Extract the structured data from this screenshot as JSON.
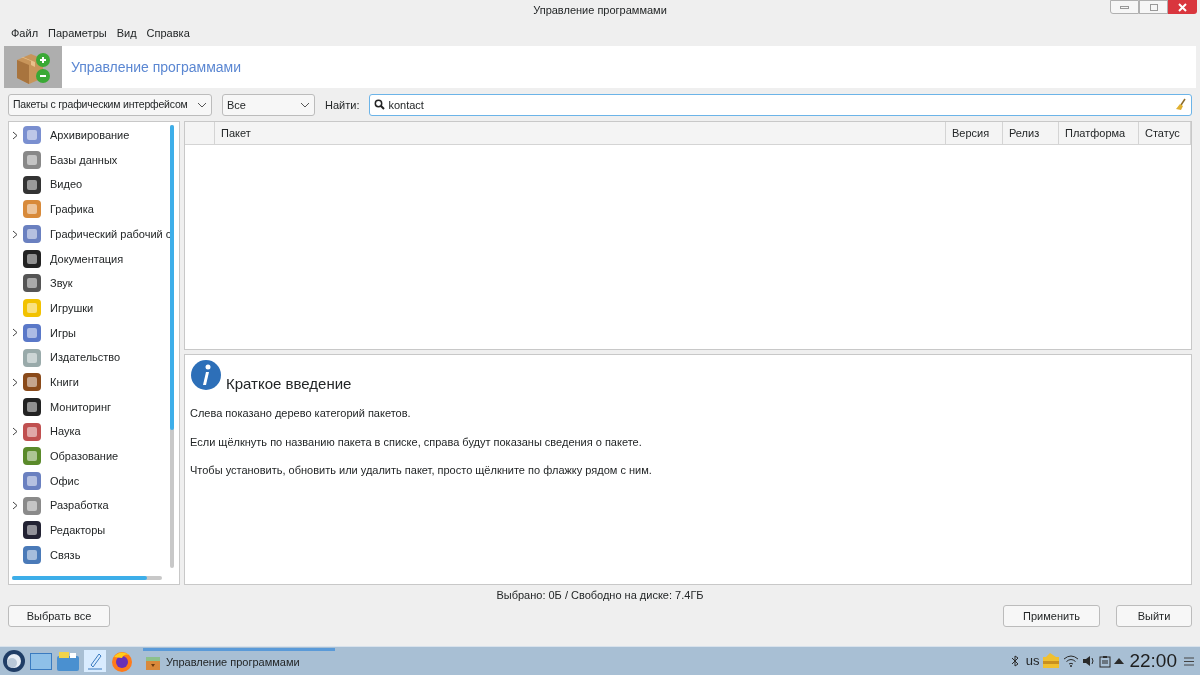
{
  "window": {
    "title": "Управление программами"
  },
  "menu": [
    "Файл",
    "Параметры",
    "Вид",
    "Справка"
  ],
  "header": {
    "title": "Управление программами"
  },
  "filters": {
    "group": "Пакеты с графическим интерфейсом",
    "status": "Все",
    "search_label": "Найти:",
    "search_value": "kontact"
  },
  "categories": [
    {
      "label": "Архивирование",
      "has_children": true
    },
    {
      "label": "Базы данных",
      "has_children": false
    },
    {
      "label": "Видео",
      "has_children": false
    },
    {
      "label": "Графика",
      "has_children": false
    },
    {
      "label": "Графический рабочий с",
      "has_children": true
    },
    {
      "label": "Документация",
      "has_children": false
    },
    {
      "label": "Звук",
      "has_children": false
    },
    {
      "label": "Игрушки",
      "has_children": false
    },
    {
      "label": "Игры",
      "has_children": true
    },
    {
      "label": "Издательство",
      "has_children": false
    },
    {
      "label": "Книги",
      "has_children": true
    },
    {
      "label": "Мониторинг",
      "has_children": false
    },
    {
      "label": "Наука",
      "has_children": true
    },
    {
      "label": "Образование",
      "has_children": false
    },
    {
      "label": "Офис",
      "has_children": false
    },
    {
      "label": "Разработка",
      "has_children": true
    },
    {
      "label": "Редакторы",
      "has_children": false
    },
    {
      "label": "Связь",
      "has_children": false
    }
  ],
  "table": {
    "columns": [
      "Пакет",
      "Версия",
      "Релиз",
      "Платформа",
      "Статус"
    ]
  },
  "info": {
    "title": "Краткое введение",
    "paragraphs": [
      "Слева показано дерево категорий пакетов.",
      "Если щёлкнуть по названию пакета в списке, справа будут показаны сведения о пакете.",
      "Чтобы установить, обновить или удалить пакет, просто щёлкните по флажку рядом с ним."
    ]
  },
  "status_bar": "Выбрано: 0Б / Свободно на диске: 7.4ГБ",
  "buttons": {
    "select_all": "Выбрать все",
    "apply": "Применить",
    "quit": "Выйти"
  },
  "taskbar": {
    "task": "Управление программами",
    "keyboard": "us",
    "clock": "22:00"
  }
}
